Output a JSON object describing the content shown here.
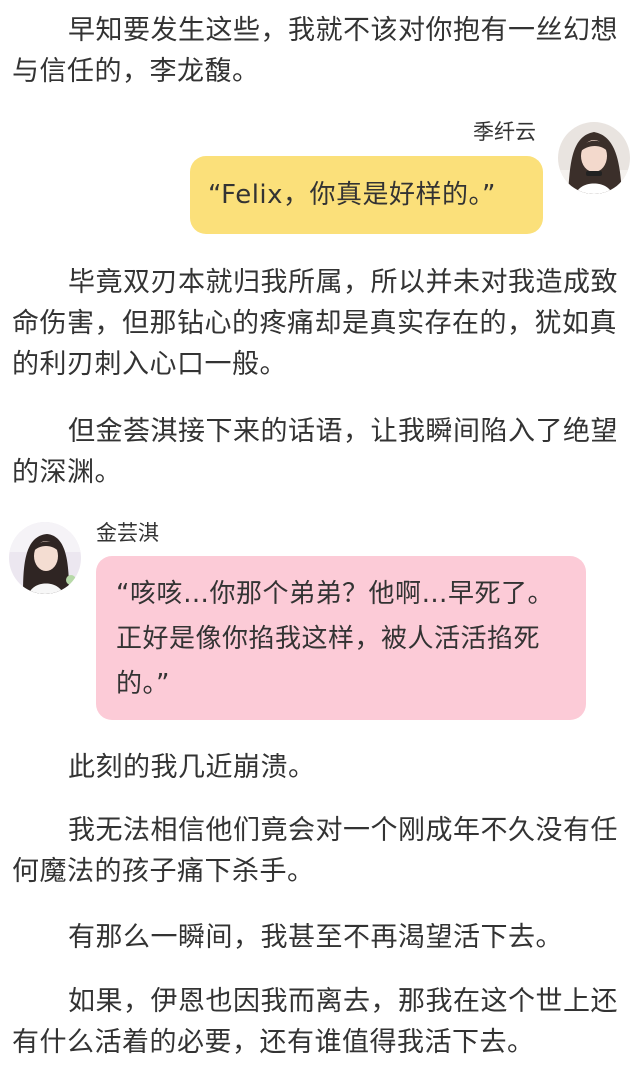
{
  "paragraphs": {
    "p1": "早知要发生这些，我就不该对你抱有一丝幻想与信任的，李龙馥。",
    "p2": "毕竟双刃本就归我所属，所以并未对我造成致命伤害，但那钻心的疼痛却是真实存在的，犹如真的利刃刺入心口一般。",
    "p3": "但金荟淇接下来的话语，让我瞬间陷入了绝望的深渊。",
    "p4": "此刻的我几近崩溃。",
    "p5": "我无法相信他们竟会对一个刚成年不久没有任何魔法的孩子痛下杀手。",
    "p6": "有那么一瞬间，我甚至不再渴望活下去。",
    "p7": "如果，伊恩也因我而离去，那我在这个世上还有什么活着的必要，还有谁值得我活下去。"
  },
  "chat1": {
    "speaker": "季纤云",
    "message": "“Felix，你真是好样的。”",
    "bubble_color": "#fbe07a",
    "avatar_icon": "girl-portrait-avatar"
  },
  "chat2": {
    "speaker": "金芸淇",
    "message": "“咳咳…你那个弟弟？他啊…早死了。正好是像你掐我这样，被人活活掐死的。”",
    "bubble_color": "#fccbd7",
    "avatar_icon": "girl-portrait-avatar"
  }
}
